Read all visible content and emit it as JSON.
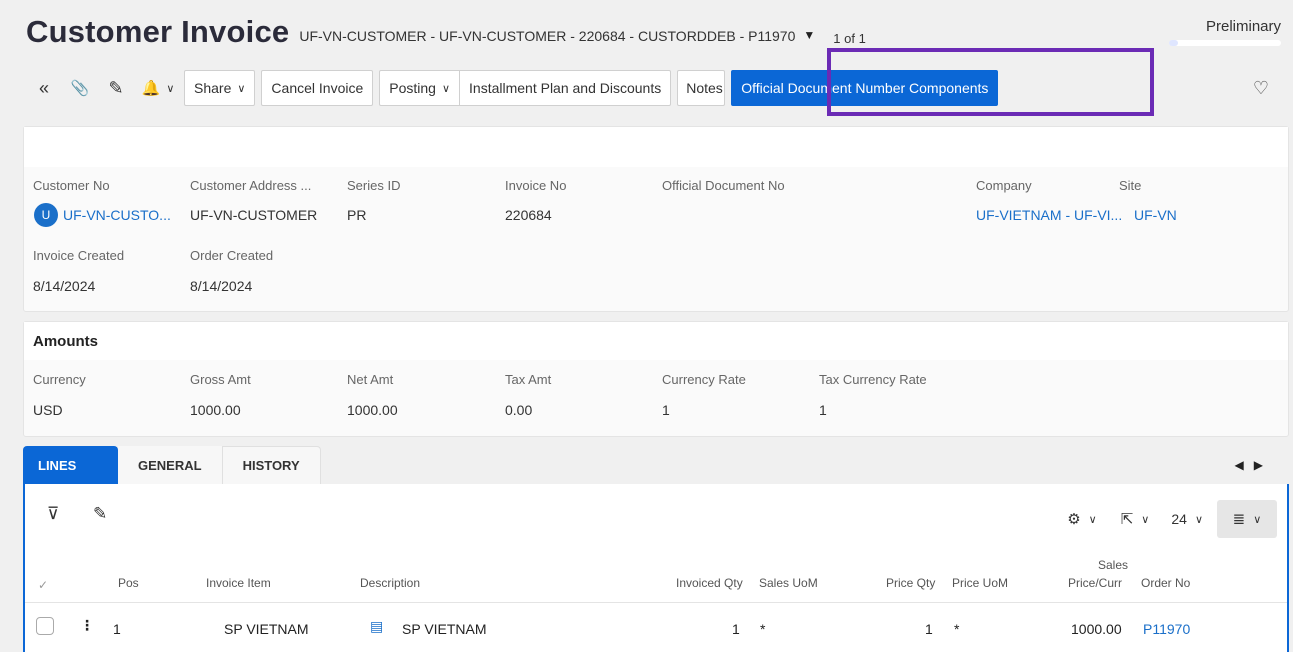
{
  "header": {
    "title": "Customer Invoice",
    "subtitle": "UF-VN-CUSTOMER - UF-VN-CUSTOMER - 220684 - CUSTORDDEB - P11970",
    "record_count": "1 of 1",
    "status": "Preliminary",
    "status_progress_pct": 8
  },
  "toolbar": {
    "share": "Share",
    "cancel_invoice": "Cancel Invoice",
    "posting": "Posting",
    "installment": "Installment Plan and Discounts",
    "notes": "Notes",
    "official_doc": "Official Document Number Components"
  },
  "details": {
    "customer_no_label": "Customer No",
    "customer_no": "UF-VN-CUSTO...",
    "avatar_letter": "U",
    "customer_address_label": "Customer Address ...",
    "customer_address": "UF-VN-CUSTOMER",
    "series_id_label": "Series ID",
    "series_id": "PR",
    "invoice_no_label": "Invoice No",
    "invoice_no": "220684",
    "official_doc_no_label": "Official Document No",
    "company_label": "Company",
    "company": "UF-VIETNAM - UF-VI...",
    "site_label": "Site",
    "site": "UF-VN",
    "invoice_created_label": "Invoice Created",
    "invoice_created": "8/14/2024",
    "order_created_label": "Order Created",
    "order_created": "8/14/2024"
  },
  "amounts": {
    "title": "Amounts",
    "currency_label": "Currency",
    "currency": "USD",
    "gross_label": "Gross Amt",
    "gross": "1000.00",
    "net_label": "Net Amt",
    "net": "1000.00",
    "tax_label": "Tax Amt",
    "tax": "0.00",
    "rate_label": "Currency Rate",
    "rate": "1",
    "tax_rate_label": "Tax Currency Rate",
    "tax_rate": "1"
  },
  "tabs": [
    "LINES",
    "GENERAL",
    "HISTORY"
  ],
  "grid": {
    "page_size": "24",
    "columns": {
      "pos": "Pos",
      "invoice_item": "Invoice Item",
      "description": "Description",
      "invoiced_qty": "Invoiced Qty",
      "sales_uom": "Sales UoM",
      "price_qty": "Price Qty",
      "price_uom": "Price UoM",
      "sales_price_1": "Sales",
      "sales_price_2": "Price/Curr",
      "order_no": "Order No"
    },
    "rows": [
      {
        "pos": "1",
        "invoice_item": "SP VIETNAM",
        "description": "SP VIETNAM",
        "invoiced_qty": "1",
        "sales_uom": "*",
        "price_qty": "1",
        "price_uom": "*",
        "sales_price": "1000.00",
        "order_no": "P11970"
      }
    ]
  },
  "icons": {
    "collapse": "«",
    "attach": "📎",
    "edit": "✎",
    "bell": "🔔",
    "heart": "♡",
    "filter": "⊽",
    "gear": "⚙",
    "export": "⇱",
    "list": "≣",
    "more": "⋮",
    "doc": "▤",
    "check": "✓",
    "caret": "▼",
    "chevron": "∨",
    "tab_left": "◀",
    "tab_right": "▶"
  }
}
